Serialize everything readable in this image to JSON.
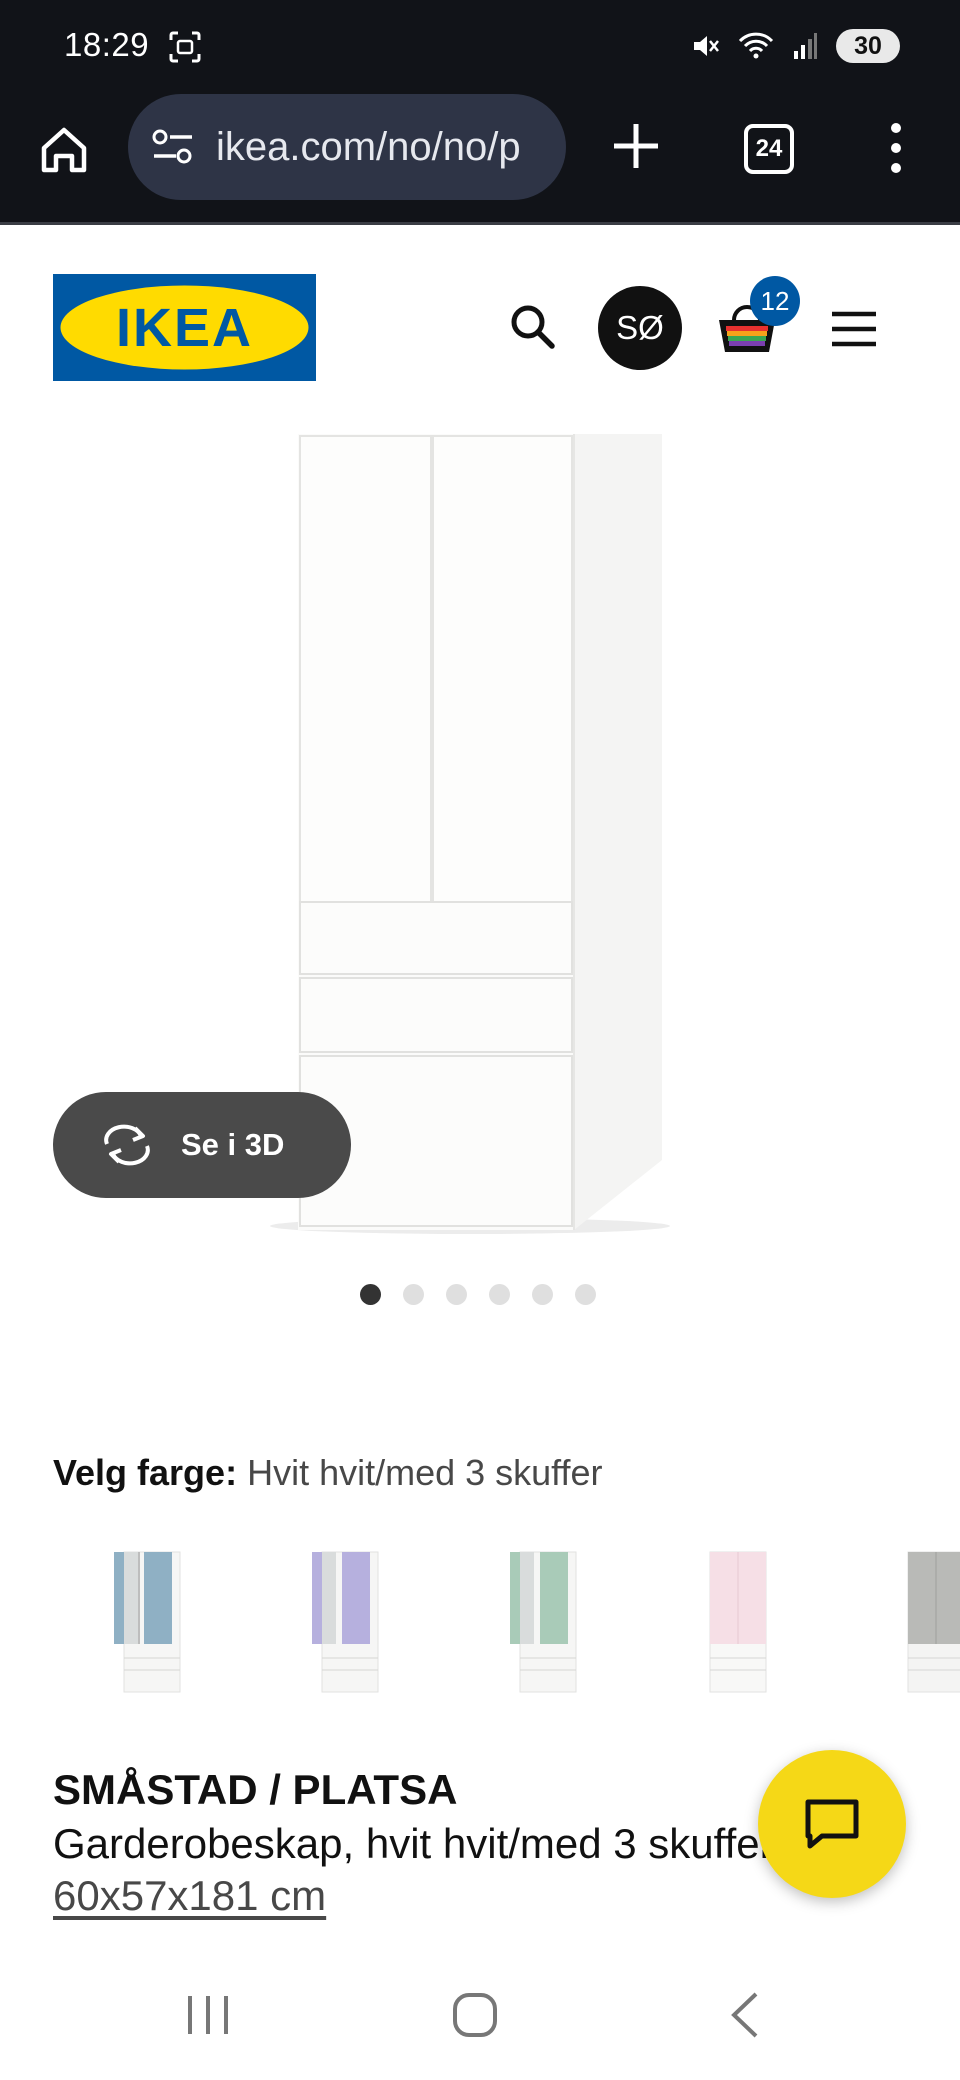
{
  "status_bar": {
    "time": "18:29",
    "battery": "30"
  },
  "browser": {
    "url": "ikea.com/no/no/p",
    "tab_count": "24"
  },
  "header": {
    "logo_text": "IKEA",
    "avatar_initials": "SØ",
    "cart_count": "12"
  },
  "gallery": {
    "view_3d_label": "Se i 3D",
    "image_count": 6,
    "active_index": 0
  },
  "color": {
    "label": "Velg farge:",
    "value": "Hvit hvit/med 3 skuffer",
    "options": [
      {
        "name": "blue",
        "door_color": "#8fb0c4"
      },
      {
        "name": "lilac",
        "door_color": "#b6b0de"
      },
      {
        "name": "mint",
        "door_color": "#a9cbb8"
      },
      {
        "name": "pink",
        "door_color": "#f6dfe6"
      },
      {
        "name": "grey",
        "door_color": "#b9bab7"
      }
    ]
  },
  "product": {
    "name": "SMÅSTAD / PLATSA",
    "description": "Garderobeskap, hvit hvit/med 3 skuffer",
    "size": "60x57x181 cm"
  },
  "colors": {
    "brand_blue": "#0058a3",
    "brand_yellow": "#ffdb00",
    "chat_yellow": "#f5d817"
  }
}
